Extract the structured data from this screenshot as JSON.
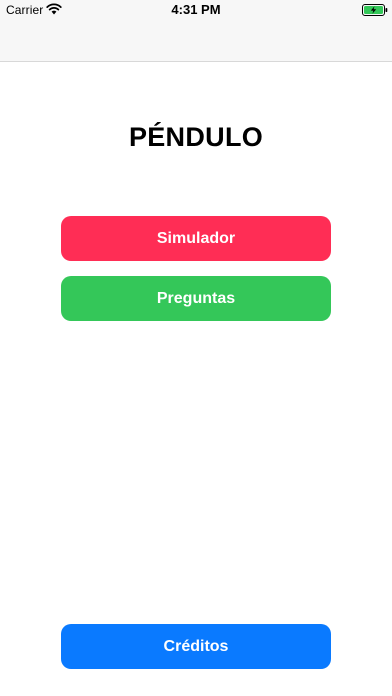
{
  "status_bar": {
    "carrier": "Carrier",
    "time": "4:31 PM",
    "wifi_icon": "wifi-icon",
    "battery_icon": "battery-charging-icon"
  },
  "main": {
    "title": "PÉNDULO",
    "buttons": {
      "simulator": "Simulador",
      "questions": "Preguntas",
      "credits": "Créditos"
    }
  },
  "colors": {
    "simulator": "#ff2d55",
    "questions": "#34c759",
    "credits": "#0a7aff",
    "battery_charge": "#34c759"
  }
}
